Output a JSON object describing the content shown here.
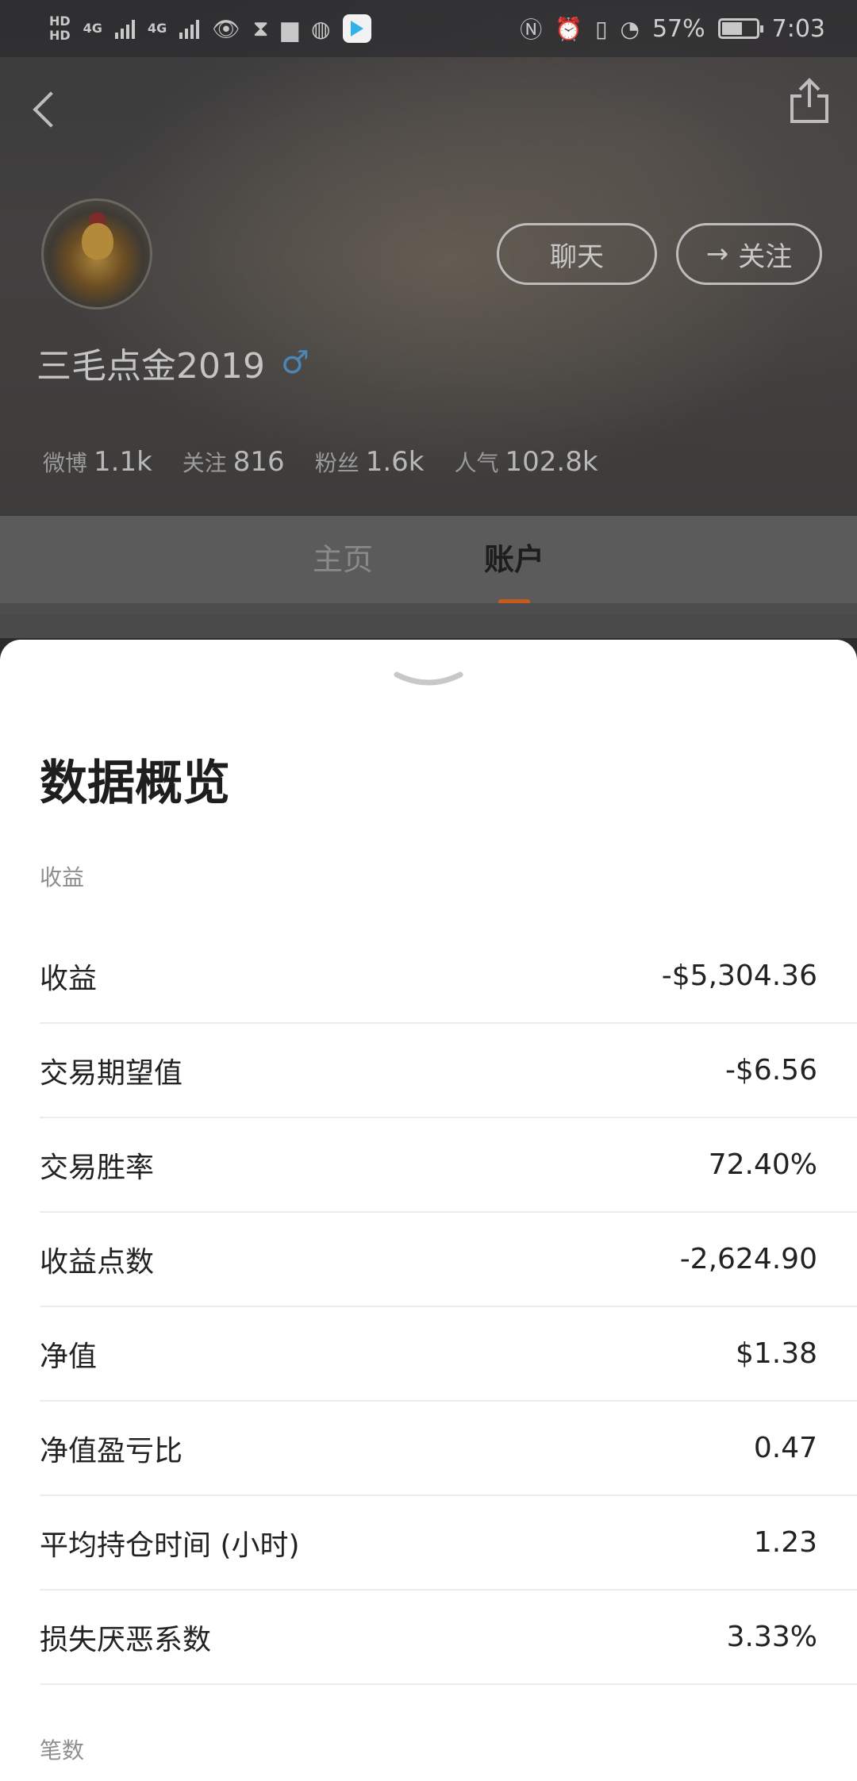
{
  "status_bar": {
    "hd1": "HD",
    "hd2": "HD",
    "net1": "4G",
    "net2": "4G",
    "battery_pct": "57%",
    "battery_level": 0.57,
    "time": "7:03",
    "icons": [
      "eye-icon",
      "hourglass-icon",
      "briefcase-icon",
      "globe-icon",
      "play-app-icon",
      "nfc-icon",
      "alarm-icon",
      "vibrate-icon",
      "speed-icon"
    ]
  },
  "header": {
    "chat_label": "聊天",
    "follow_label": "关注",
    "follow_prefix": "→",
    "username": "三毛点金2019",
    "gender_symbol": "♂",
    "stats": [
      {
        "label": "微博",
        "value": "1.1k"
      },
      {
        "label": "关注",
        "value": "816"
      },
      {
        "label": "粉丝",
        "value": "1.6k"
      },
      {
        "label": "人气",
        "value": "102.8k"
      }
    ]
  },
  "tabs": [
    {
      "label": "主页",
      "active": false
    },
    {
      "label": "账户",
      "active": true
    }
  ],
  "sheet": {
    "title": "数据概览",
    "section_income": "收益",
    "rows": [
      {
        "label": "收益",
        "value": "-$5,304.36"
      },
      {
        "label": "交易期望值",
        "value": "-$6.56"
      },
      {
        "label": "交易胜率",
        "value": "72.40%"
      },
      {
        "label": "收益点数",
        "value": "-2,624.90"
      },
      {
        "label": "净值",
        "value": "$1.38"
      },
      {
        "label": "净值盈亏比",
        "value": "0.47"
      },
      {
        "label": "平均持仓时间 (小时)",
        "value": "1.23"
      },
      {
        "label": "损失厌恶系数",
        "value": "3.33%"
      }
    ],
    "section_count": "笔数"
  },
  "colors": {
    "accent": "#c75a1c",
    "gender": "#4b86b9"
  }
}
